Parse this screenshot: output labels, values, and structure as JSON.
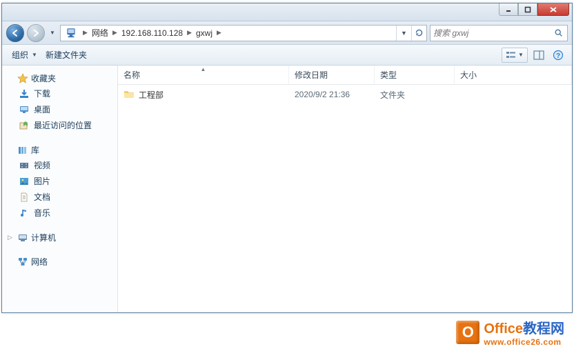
{
  "titlebar": {},
  "address": {
    "segments": [
      "网络",
      "192.168.110.128",
      "gxwj"
    ]
  },
  "search": {
    "placeholder": "搜索 gxwj"
  },
  "toolbar": {
    "organize": "组织",
    "new_folder": "新建文件夹"
  },
  "sidebar": {
    "favorites": {
      "label": "收藏夹",
      "items": [
        {
          "label": "下载"
        },
        {
          "label": "桌面"
        },
        {
          "label": "最近访问的位置"
        }
      ]
    },
    "libraries": {
      "label": "库",
      "items": [
        {
          "label": "视频"
        },
        {
          "label": "图片"
        },
        {
          "label": "文档"
        },
        {
          "label": "音乐"
        }
      ]
    },
    "computer": {
      "label": "计算机"
    },
    "network": {
      "label": "网络"
    }
  },
  "columns": {
    "name": "名称",
    "date": "修改日期",
    "type": "类型",
    "size": "大小"
  },
  "rows": [
    {
      "name": "工程部",
      "date": "2020/9/2 21:36",
      "type": "文件夹",
      "size": ""
    }
  ],
  "watermark": {
    "line1_a": "Office",
    "line1_b": "教程网",
    "line2": "www.office26.com"
  }
}
